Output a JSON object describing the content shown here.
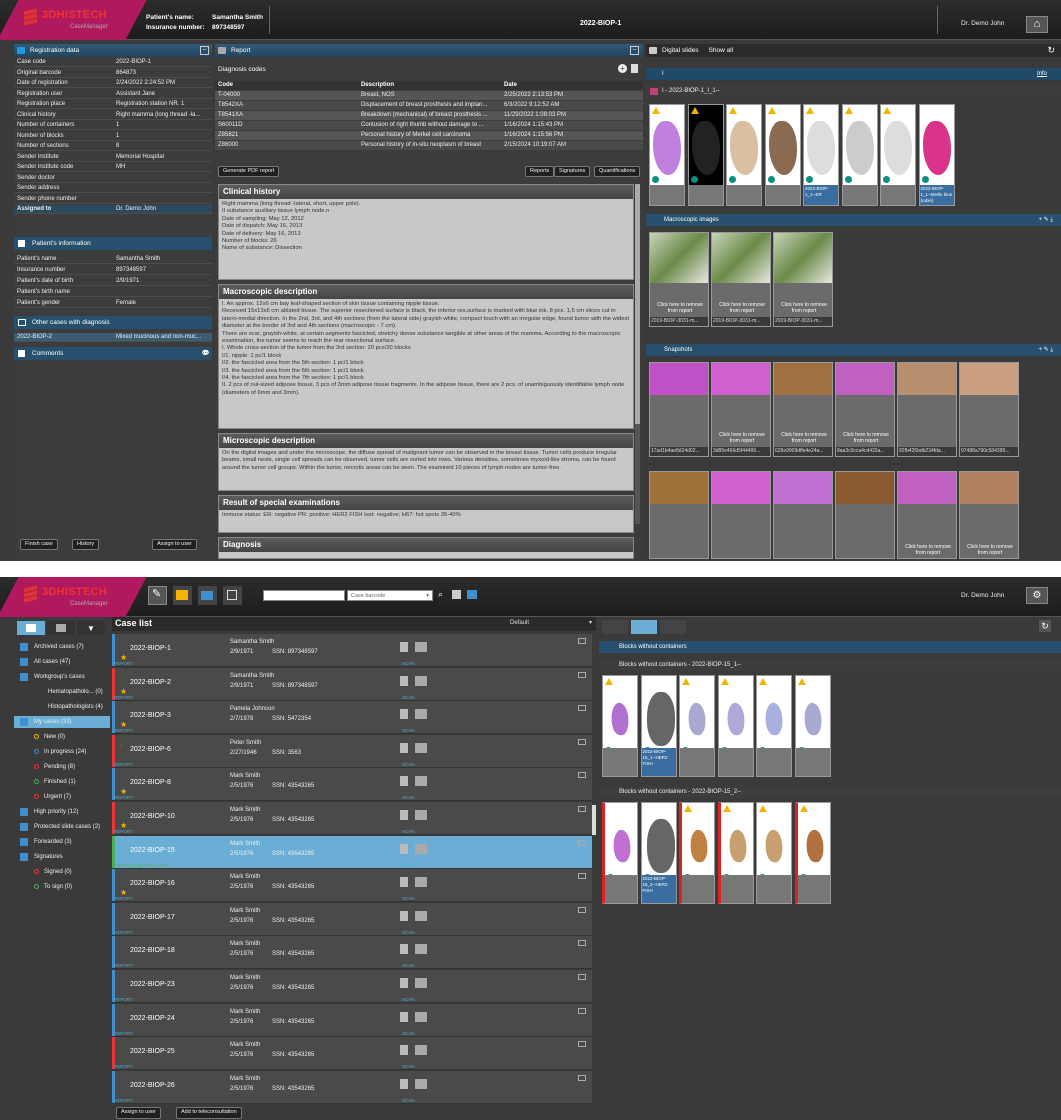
{
  "app": {
    "brand": "3DHISTECH",
    "subtitle": "CaseManager",
    "user": "Dr. Demo John"
  },
  "top1": {
    "patient_name_label": "Patient's name:",
    "patient_name": "Samantha Smith",
    "insurance_label": "Insurance number:",
    "insurance": "897348597",
    "case_title": "2022-BIOP-1"
  },
  "registration": {
    "title": "Registration data",
    "rows": [
      [
        "Case code",
        "2022-BIOP-1"
      ],
      [
        "Original barcode",
        "864873"
      ],
      [
        "Date of registration",
        "2/24/2022 2:24:52 PM"
      ],
      [
        "Registration user",
        "Assistant Jane"
      ],
      [
        "Registration place",
        "Registration station NR. 1"
      ],
      [
        "Clinical history",
        "Right mamma (long thread -la..."
      ],
      [
        "Number of containers",
        "1"
      ],
      [
        "Number of blocks",
        "1"
      ],
      [
        "Number of sections",
        "8"
      ],
      [
        "Sender institute",
        "Memorial Hospital"
      ],
      [
        "Sender institute code",
        "MH"
      ],
      [
        "Sender doctor",
        ""
      ],
      [
        "Sender address",
        ""
      ],
      [
        "Sender phone number",
        ""
      ],
      [
        "Assigned to",
        "Dr. Demo John"
      ]
    ],
    "patient_title": "Patient's information",
    "patient_rows": [
      [
        "Patient's name",
        "Samantha Smith"
      ],
      [
        "Insurance number",
        "897348597"
      ],
      [
        "Patient's date of birth",
        "2/9/1971"
      ],
      [
        "Patient's birth name",
        ""
      ],
      [
        "Patient's gender",
        "Female"
      ]
    ],
    "other_title": "Other cases with diagnosis",
    "other_rows": [
      [
        "2022-BIOP-2",
        "Mixed mucinous and non-muc..."
      ]
    ],
    "comments_title": "Comments",
    "finish_btn": "Finish case",
    "history_btn": "History",
    "assign_btn": "Assign to user"
  },
  "report": {
    "title": "Report",
    "diag_title": "Diagnosis codes",
    "cols": [
      "Code",
      "Description",
      "Date"
    ],
    "rows": [
      [
        "T-04000",
        "Breast, NOS",
        "2/25/2022 2:13:53 PM"
      ],
      [
        "T8542XA",
        "Displacement of breast prosthesis and implan...",
        "6/3/2022 9:12:52 AM"
      ],
      [
        "T8541XA",
        "Breakdown (mechanical) of breast prosthesis ...",
        "11/29/2022 1:08:03 PM"
      ],
      [
        "S60011D",
        "Contusion of right thumb without damage to ...",
        "1/16/2024 1:15:43 PM"
      ],
      [
        "Z85821",
        "Personal history of Merkel cell carcinoma",
        "1/16/2024 1:15:56 PM"
      ],
      [
        "Z86000",
        "Personal history of in-situ neoplasm of breast",
        "2/15/2024 10:19:07 AM"
      ]
    ],
    "pdf_btn": "Generate PDF report",
    "reports_btn": "Reports",
    "sign_btn": "Signatures",
    "quant_btn": "Quantifications",
    "clinical_title": "Clinical history",
    "clinical_text": "Right mamma (long thread -lateral, short, upper pole).\nII substance auxiliary tissue lymph node.n\nDate of sampling: May 12, 2012\nDate of dispatch: May 16, 2013\nDate of delivery: May 16, 2013\nNumber of blocks: 26\nName of substance: Dissection",
    "macro_title": "Macroscopic description",
    "macro_text": "I. An approx. 12x6 cm bay leaf-shaped section of skin tissue containing nipple tissue.\nReceived 15x13x6 cm ablated tissue. The superior resectioned surface is black, the inferior res.surface is marked with blue ink. 8 pcs. 1,5 cm slices cut in latero-medial direction. In the 2nd, 3rd, and 4th sections (from the lateral side) grayish white, compact touch with an irregular edge, found tumor with the widest diameter at the border of 3rd and 4th sections (macroscopic - 7 cm).\nThere are scar, grayish-white, at certain segments fascicled, stretchy dense substance tangible at other areas of the mamma. According to the macroscopic examination, the tumor seems to reach the rear resectional surface.\nI. Whole cross-section of the tumor from the 3rd section: 20 pcs/20 blocks\nI/1. nipple: 1 pc/1 block\nI/2. the fascicled area from the 5th section: 1 pc/1 block\nI/3. the fascicled area from the 6th section: 1 pc/1 block\nI/4. the fascicled area from the 7th section: 1 pc/1 block\nII. 2 pcs of nut-sized adipose tissue, 3 pcs of 3mm adipose tissue fragments. In the adipose tissue, there are 2 pcs. of unambiguously identifiable lymph node (diameters of 6mm and 3mm).",
    "micro_title": "Microscopic description",
    "micro_text": "On the digital images and under the microscope, the diffuse spread of malignant tumor can be observed in the breast tissue. Tumor cells produce irregular beams, small nests, single cell spreads can be observed, tumor cells are sorted into rows. Various densities, sometimes myxoid-like stroma, can be found around the tumor cell groups. Within the tumor, necrotic areas can be seen. The examined 10 pieces of lymph nodes are tumor-free.",
    "special_title": "Result of special examinations",
    "special_text": "Immune status: ER: negative PR: positive: HER2 FISH test: negative; ki67: hot spots 35-40%",
    "diagnosis_title": "Diagnosis"
  },
  "slides": {
    "title": "Digital slides",
    "show_all": "Show all",
    "group": "I",
    "info": "Info",
    "sub": "I - 2022-BIOP-1_I_1--",
    "labels": [
      "",
      "",
      "",
      "",
      "2022-BIOP-1_1--ER",
      "",
      "",
      "2022-BIOP-1_1--Berlin blue (rubin)"
    ],
    "macro_title": "Macroscopic images",
    "macro_caps": [
      "2019-BIOP-3031-m...",
      "2019-BIOP-3031-m...",
      "2019-BIOP-3031-m..."
    ],
    "remove": "Click here to remove from report",
    "snap_title": "Snapshots",
    "snap_caps": [
      "17ad1b4ae8d24d02...",
      "3d85e466d5f44496...",
      "628e9909dffe4e24a...",
      "8aa3c0cca4cd433a...",
      "92fb426bdb234fda...",
      "97488a790c584399..."
    ]
  },
  "top2": {
    "search_placeholder": "Case barcode"
  },
  "nav": {
    "items": [
      [
        "Archived cases (7)",
        0
      ],
      [
        "All cases (47)",
        0
      ],
      [
        "Workgroup's cases",
        0
      ],
      [
        "Hematopatholo...  (0)",
        1
      ],
      [
        "Histopathologists (4)",
        1
      ],
      [
        "My cases (33)",
        0
      ],
      [
        "New (0)",
        2
      ],
      [
        "In progress (24)",
        2
      ],
      [
        "Pending (8)",
        2
      ],
      [
        "Finished (1)",
        2
      ],
      [
        "Urgent (7)",
        2
      ],
      [
        "High priority (12)",
        0
      ],
      [
        "Protected slide cases (2)",
        0
      ],
      [
        "Forwarded (3)",
        0
      ],
      [
        "Signatures",
        0
      ],
      [
        "Signed (0)",
        2
      ],
      [
        "To sign (0)",
        2
      ]
    ]
  },
  "caselist": {
    "title": "Case list",
    "filter": "Default",
    "report_tag": "REPORT",
    "scan_tag": "SCAN",
    "ssn_label": "SSN:",
    "rows": [
      [
        "2022-BIOP-1",
        "Samantha Smith",
        "2/9/1971",
        "897348597"
      ],
      [
        "2022-BIOP-2",
        "Samantha Smith",
        "2/9/1971",
        "897348597"
      ],
      [
        "2022-BIOP-3",
        "Pamela Johnson",
        "2/7/1978",
        "5472354"
      ],
      [
        "2022-BIOP-6",
        "Peter Smith",
        "2/27/1946",
        "3563"
      ],
      [
        "2022-BIOP-8",
        "Mark Smith",
        "2/5/1976",
        "43543265"
      ],
      [
        "2022-BIOP-10",
        "Mark Smith",
        "2/5/1976",
        "43543265"
      ],
      [
        "2022-BIOP-15",
        "Mark Smith",
        "2/5/1976",
        "43543265"
      ],
      [
        "2022-BIOP-16",
        "Mark Smith",
        "2/5/1976",
        "43543265"
      ],
      [
        "2022-BIOP-17",
        "Mark Smith",
        "2/5/1976",
        "43543265"
      ],
      [
        "2022-BIOP-18",
        "Mark Smith",
        "2/5/1976",
        "43543265"
      ],
      [
        "2022-BIOP-23",
        "Mark Smith",
        "2/5/1976",
        "43543265"
      ],
      [
        "2022-BIOP-24",
        "Mark Smith",
        "2/5/1976",
        "43543265"
      ],
      [
        "2022-BIOP-25",
        "Mark Smith",
        "2/5/1976",
        "43543265"
      ],
      [
        "2022-BIOP-26",
        "Mark Smith",
        "2/5/1976",
        "43543265"
      ]
    ],
    "finished_by": "Finished by Dr. Demo John",
    "assign_btn": "Assign to user",
    "tele_btn": "Add to teleconsultation"
  },
  "blocks": {
    "title": "Blocks without containers",
    "g1": "Blocks without containers - 2022-BIOP-15_1--",
    "g2": "Blocks without containers - 2022-BIOP-15_2--",
    "g1_label": "2022-BIOP-15_1--HER2 FISH",
    "g2_label": "2022-BIOP-15_2--HER2 FISH"
  },
  "colors": {
    "accent": "#b1195f",
    "header": "#27506e",
    "selected": "#6aaed6",
    "warn": "#f4b400"
  }
}
